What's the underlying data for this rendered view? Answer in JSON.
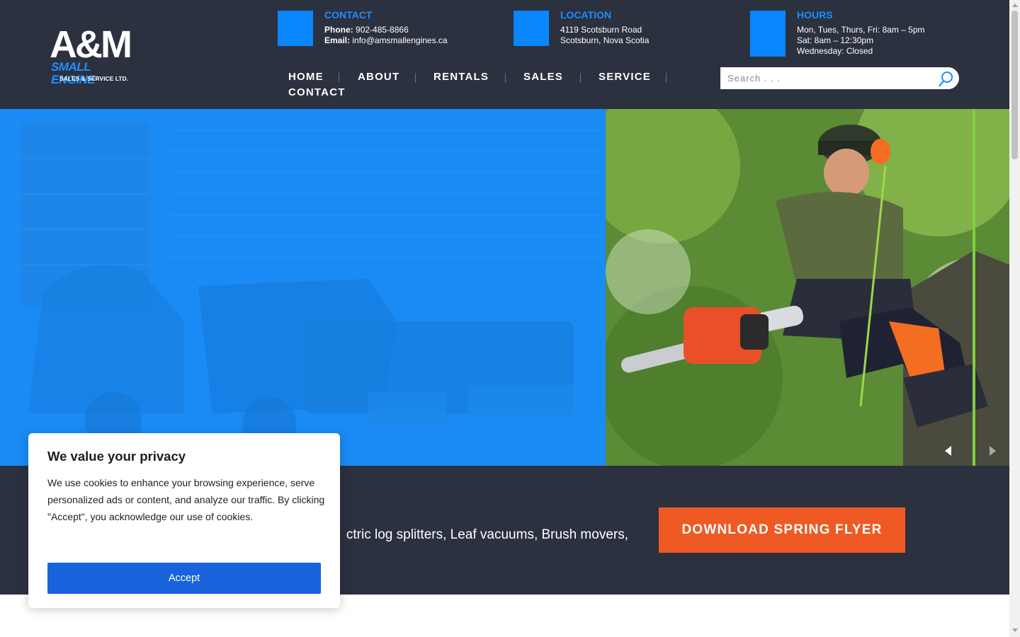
{
  "logo": {
    "line1": "A&M",
    "line2": "SMALL ENGINE",
    "line3": "SALES & SERVICE LTD."
  },
  "contact": {
    "heading": "CONTACT",
    "phone_label": "Phone:",
    "phone": "902-485-8866",
    "email_label": "Email:",
    "email": "info@amsmallengines.ca"
  },
  "location": {
    "heading": "LOCATION",
    "line1": "4119 Scotsburn Road",
    "line2": "Scotsburn, Nova Scotia"
  },
  "hours": {
    "heading": "HOURS",
    "line1": "Mon, Tues, Thurs, Fri: 8am – 5pm",
    "line2": "Sat: 8am – 12:30pm",
    "line3": "Wednesday: Closed"
  },
  "nav": {
    "items": [
      "HOME",
      "ABOUT",
      "RENTALS",
      "SALES",
      "SERVICE",
      "CONTACT"
    ]
  },
  "search": {
    "placeholder": "Search . . ."
  },
  "band": {
    "text": "ctric log splitters, Leaf vacuums, Brush movers,",
    "button_label": "DOWNLOAD SPRING FLYER"
  },
  "cookie": {
    "title": "We value your privacy",
    "body": "We use cookies to enhance your browsing experience, serve personalized ads or content, and analyze our traffic. By clicking \"Accept\", you acknowledge our use of cookies.",
    "accept_label": "Accept"
  },
  "colors": {
    "header_bg": "#2c3140",
    "accent_blue": "#0a86ff",
    "hero_blue": "#1a8bf5",
    "cta_orange": "#ef5a24",
    "accept_blue": "#1863dc"
  },
  "icons": {
    "search": "search-icon",
    "slider_prev": "chevron-left-icon",
    "slider_next": "chevron-right-icon"
  }
}
